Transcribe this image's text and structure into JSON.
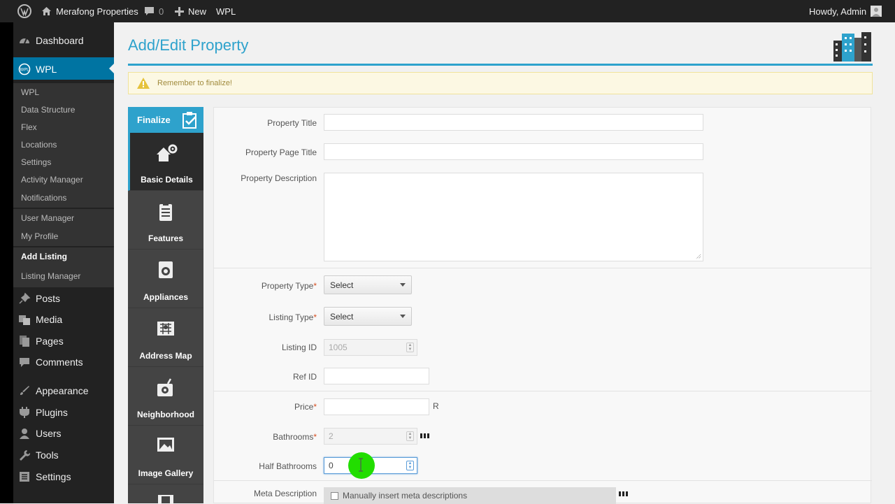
{
  "topbar": {
    "site": "Merafong Properties",
    "comments": "0",
    "new": "New",
    "wpl": "WPL",
    "howdy": "Howdy, Admin"
  },
  "menu": {
    "dashboard": "Dashboard",
    "wpl": "WPL",
    "sub": [
      "WPL",
      "Data Structure",
      "Flex",
      "Locations",
      "Settings",
      "Activity Manager",
      "Notifications",
      "User Manager",
      "My Profile",
      "Add Listing",
      "Listing Manager"
    ],
    "posts": "Posts",
    "media": "Media",
    "pages": "Pages",
    "comments": "Comments",
    "appearance": "Appearance",
    "plugins": "Plugins",
    "users": "Users",
    "tools": "Tools",
    "settings": "Settings"
  },
  "page": {
    "title": "Add/Edit Property",
    "notice": "Remember to finalize!"
  },
  "tabs": {
    "finalize": "Finalize",
    "items": [
      "Basic Details",
      "Features",
      "Appliances",
      "Address Map",
      "Neighborhood",
      "Image Gallery"
    ]
  },
  "form": {
    "property_title": "Property Title",
    "page_title": "Property Page Title",
    "description": "Property Description",
    "property_type": "Property Type",
    "listing_type": "Listing Type",
    "select": "Select",
    "listing_id": "Listing ID",
    "listing_id_value": "1005",
    "ref_id": "Ref ID",
    "price": "Price",
    "currency": "R",
    "bathrooms": "Bathrooms",
    "bathrooms_value": "2",
    "half_bathrooms": "Half Bathrooms",
    "half_bathrooms_value": "0",
    "meta_description": "Meta Description",
    "meta_checkbox": "Manually insert meta descriptions",
    "required_mark": "*"
  },
  "colors": {
    "accent": "#2ea2cc",
    "admin_bar": "#222222",
    "notice_bg": "#fcf8e3",
    "cursor_highlight": "#22dd00"
  }
}
